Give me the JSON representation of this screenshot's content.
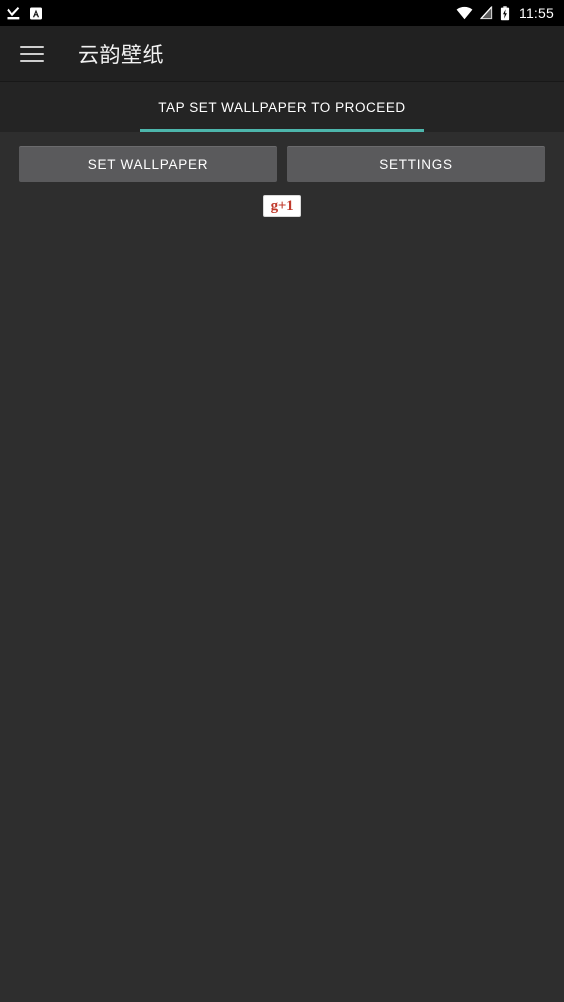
{
  "status_bar": {
    "background": "#000000",
    "time": "11:55",
    "left_icons": [
      {
        "name": "download-complete-icon",
        "glyph": "download-check"
      },
      {
        "name": "notification-app-icon",
        "glyph": "letter-a-badge",
        "letter": "A"
      }
    ],
    "right_icons": [
      {
        "name": "wifi-icon",
        "glyph": "wifi-full"
      },
      {
        "name": "no-sim-icon",
        "glyph": "signal-off"
      },
      {
        "name": "battery-charging-icon",
        "glyph": "battery-bolt"
      }
    ]
  },
  "app_bar": {
    "background": "#212121",
    "menu_icon": "hamburger-menu-icon",
    "title": "云韵壁纸"
  },
  "tabs": {
    "background": "#242424",
    "indicator_color": "#4db6ac",
    "items": [
      {
        "label": "TAP SET WALLPAPER TO PROCEED",
        "selected": true
      }
    ]
  },
  "main": {
    "background": "#2e2e2e",
    "buttons": [
      {
        "label": "SET WALLPAPER",
        "color": "#5a5a5c"
      },
      {
        "label": "SETTINGS",
        "color": "#5a5a5c"
      }
    ],
    "plus_one": {
      "label": "g+1",
      "text_color": "#c0392b",
      "background": "#ffffff"
    }
  }
}
